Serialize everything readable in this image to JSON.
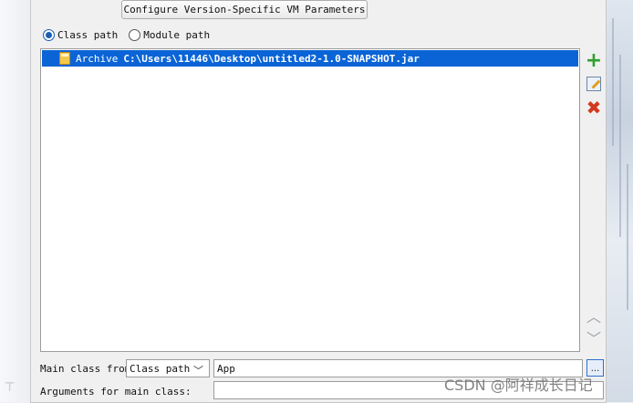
{
  "top_button": {
    "label": "Configure Version-Specific VM Parameters"
  },
  "path_mode": {
    "options": [
      {
        "label": "Class path",
        "selected": true
      },
      {
        "label": "Module path",
        "selected": false
      }
    ]
  },
  "entries": [
    {
      "kind": "Archive",
      "path": "C:\\Users\\11446\\Desktop\\untitled2-1.0-SNAPSHOT.jar",
      "icon": "jar-file-icon",
      "selected": true
    }
  ],
  "side_toolbar": {
    "add_icon": "add-icon",
    "edit_icon": "edit-icon",
    "remove_icon": "remove-icon",
    "move_up_icon": "move-up-icon",
    "move_down_icon": "move-down-icon"
  },
  "main_class": {
    "label": "Main class from",
    "source_value": "Class path",
    "class_value": "App",
    "browse_label": "..."
  },
  "arguments": {
    "label": "Arguments for main class:",
    "value": ""
  },
  "watermark": "CSDN @阿祥成长日记",
  "colors": {
    "selection": "#0a64d6",
    "add": "#2ea02e",
    "remove": "#d23a1f",
    "radio": "#1a5fb4"
  }
}
